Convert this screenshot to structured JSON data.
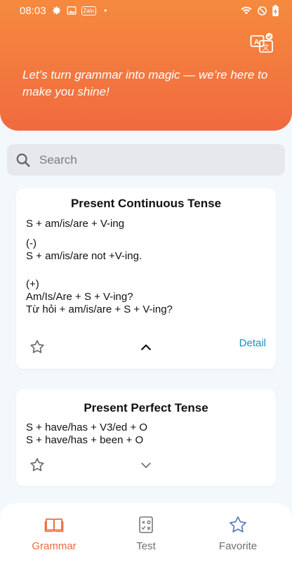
{
  "status_bar": {
    "time": "08:03",
    "zalo_label": "Zalo",
    "dot": "•"
  },
  "header": {
    "tagline": "Let’s turn grammar into magic — we’re here to make you shine!",
    "translate_icon": "translate-icon"
  },
  "search": {
    "placeholder": "Search"
  },
  "cards": [
    {
      "title": "Present Continuous Tense",
      "lines": [
        "S + am/is/are + V-ing",
        "(-)\nS + am/is/are not +V-ing.",
        "(+)\nAm/Is/Are + S + V-ing?\nTừ hỏi + am/is/are + S + V-ing?"
      ],
      "detail_label": "Detail",
      "expanded": true
    },
    {
      "title": "Present Perfect Tense",
      "lines": [
        "S + have/has + V3/ed + O\nS + have/has + been + O"
      ],
      "expanded": false
    }
  ],
  "bottom_nav": {
    "items": [
      {
        "label": "Grammar",
        "icon": "book-icon",
        "active": true
      },
      {
        "label": "Test",
        "icon": "test-icon",
        "active": false
      },
      {
        "label": "Favorite",
        "icon": "star-icon",
        "active": false
      }
    ]
  },
  "colors": {
    "accent": "#f06a3f",
    "link": "#1a8fc4",
    "header_top": "#f58a3e"
  }
}
